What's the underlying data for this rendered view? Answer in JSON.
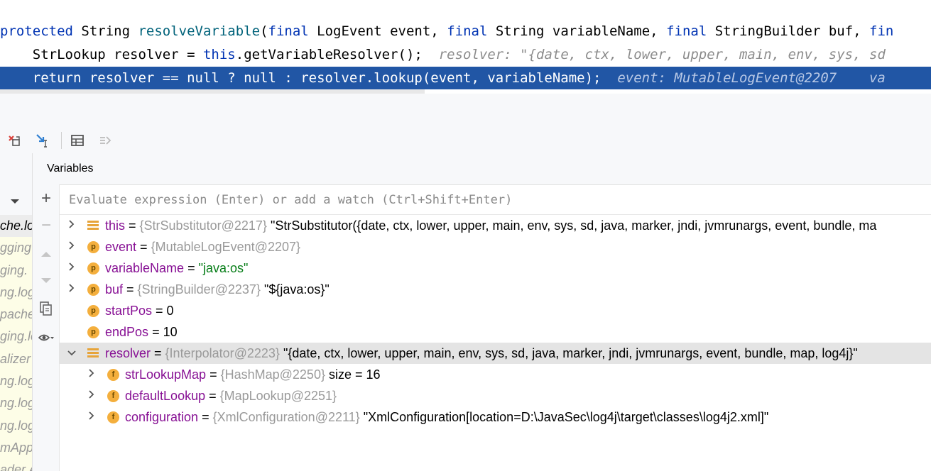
{
  "editor": {
    "line1": {
      "kw_protected": "protected",
      "type_string": " String ",
      "method": "resolveVariable",
      "paren": "(",
      "kw_final1": "final",
      "p1": " LogEvent event, ",
      "kw_final2": "final",
      "p2": " String variableName, ",
      "kw_final3": "final",
      "p3": " StringBuilder buf, ",
      "kw_final4": "fin"
    },
    "line2": {
      "code_a": "    StrLookup resolver = ",
      "kw_this": "this",
      "code_b": ".getVariableResolver();",
      "hint": "  resolver: \"{date, ctx, lower, upper, main, env, sys, sd"
    },
    "line3": {
      "code": "    return resolver == null ? null : resolver.lookup(event, variableName);",
      "hint1": "  event: MutableLogEvent@2207",
      "hint2": "    va"
    }
  },
  "toolbar": {
    "icons": [
      "drop-frame-icon",
      "smart-step-into-icon",
      "table-view-icon",
      "settings-filter-icon"
    ]
  },
  "frames": {
    "items": [
      "che.lo",
      "gging",
      "ging.",
      "ng.log",
      "pache.",
      "ging.lo",
      "alizer",
      "ng.log4",
      "ng.log",
      "ng.log4",
      "mApp",
      "ader.A"
    ],
    "selected_index": 0
  },
  "variables": {
    "title": "Variables",
    "eval_placeholder": "Evaluate expression (Enter) or add a watch (Ctrl+Shift+Enter)",
    "rows": [
      {
        "name": "this",
        "type": "{StrSubstitutor@2217}",
        "value": "\"StrSubstitutor({date, ctx, lower, upper, main, env, sys, sd, java, marker, jndi, jvmrunargs, event, bundle, ma",
        "badge": "lines",
        "expander": "right"
      },
      {
        "name": "event",
        "type": "{MutableLogEvent@2207}",
        "value": "",
        "badge": "p",
        "expander": "right"
      },
      {
        "name": "variableName",
        "type": "",
        "value": "\"java:os\"",
        "badge": "p",
        "expander": "right",
        "is_string": true
      },
      {
        "name": "buf",
        "type": "{StringBuilder@2237}",
        "value": "\"${java:os}\"",
        "badge": "p",
        "expander": "right"
      },
      {
        "name": "startPos",
        "type": "",
        "value": "0",
        "badge": "p",
        "expander": ""
      },
      {
        "name": "endPos",
        "type": "",
        "value": "10",
        "badge": "p",
        "expander": ""
      },
      {
        "name": "resolver",
        "type": "{Interpolator@2223}",
        "value": "\"{date, ctx, lower, upper, main, env, sys, sd, java, marker, jndi, jvmrunargs, event, bundle, map, log4j}\"",
        "badge": "lines",
        "expander": "down",
        "selected": true
      },
      {
        "name": "strLookupMap",
        "type": "{HashMap@2250}",
        "value": " size = 16",
        "badge": "f",
        "expander": "right",
        "child": true
      },
      {
        "name": "defaultLookup",
        "type": "{MapLookup@2251}",
        "value": "",
        "badge": "f",
        "expander": "right",
        "child": true
      },
      {
        "name": "configuration",
        "type": "{XmlConfiguration@2211}",
        "value": "\"XmlConfiguration[location=D:\\JavaSec\\log4j\\target\\classes\\log4j2.xml]\"",
        "badge": "f",
        "expander": "right",
        "child": true
      }
    ],
    "equals": " = "
  },
  "colors": {
    "selection": "#2156a5",
    "keyword": "#0033b3",
    "method": "#00627a",
    "var_name": "#871094",
    "string": "#067d17",
    "badge": "#f4af3d"
  }
}
